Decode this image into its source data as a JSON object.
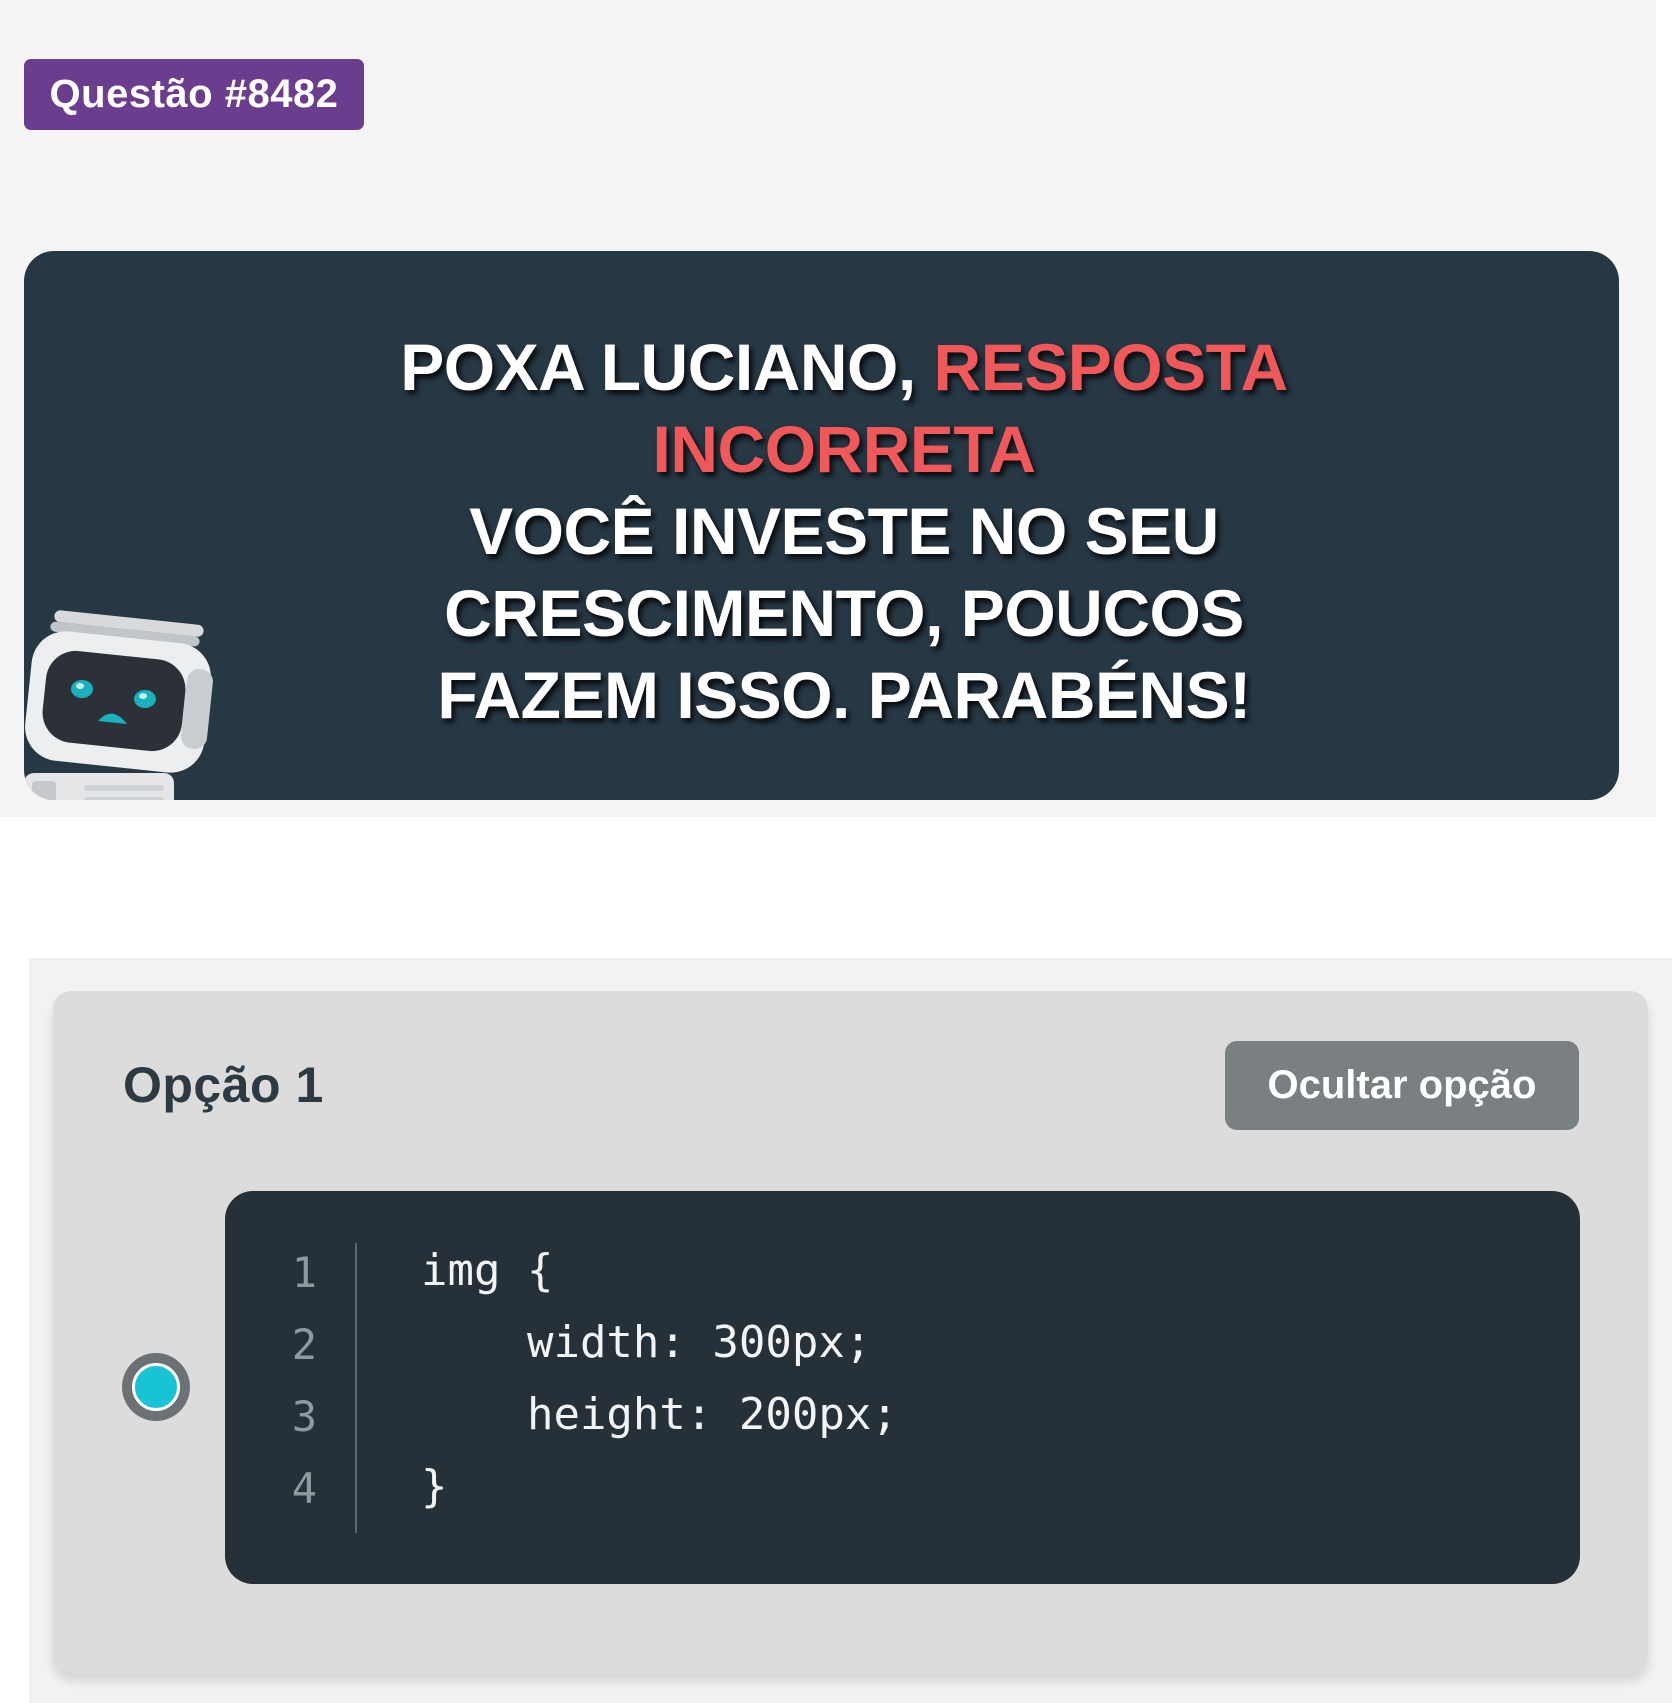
{
  "question": {
    "badge_label": "Questão #8482"
  },
  "feedback": {
    "line1_prefix": "POXA LUCIANO, ",
    "line1_highlight": "RESPOSTA",
    "line2_highlight": "INCORRETA",
    "line3": "VOCÊ INVESTE NO SEU",
    "line4": "CRESCIMENTO, POUCOS",
    "line5": "FAZEM ISSO. PARABÉNS!",
    "highlight_color": "#f0585a",
    "mascot_icon": "robot-icon"
  },
  "option": {
    "title": "Opção 1",
    "hide_button_label": "Ocultar opção",
    "selected": true,
    "radio_color": "#19c3d6",
    "code": {
      "line_numbers": [
        "1",
        "2",
        "3",
        "4"
      ],
      "lines": [
        "img {",
        "    width: 300px;",
        "    height: 200px;",
        "}"
      ]
    }
  },
  "colors": {
    "badge_bg": "#6a3d8f",
    "banner_bg": "#273845",
    "code_bg": "#263038",
    "button_bg": "#7a7f82"
  }
}
